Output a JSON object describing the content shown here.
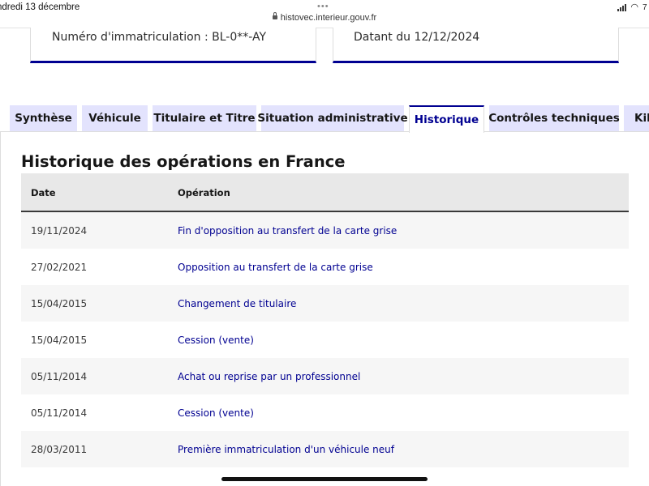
{
  "status_bar": {
    "date": "ndredi 13 décembre",
    "url": "histovec.interieur.gouv.fr",
    "battery_partial": "7"
  },
  "cards": {
    "left": "Numéro d'immatriculation : BL-0**-AY",
    "right": "Datant du 12/12/2024"
  },
  "tabs": [
    {
      "label": "Synthèse",
      "active": false
    },
    {
      "label": "Véhicule",
      "active": false
    },
    {
      "label": "Titulaire et Titre",
      "active": false
    },
    {
      "label": "Situation administrative",
      "active": false
    },
    {
      "label": "Historique",
      "active": true
    },
    {
      "label": "Contrôles techniques",
      "active": false
    },
    {
      "label": "Kilo",
      "active": false
    }
  ],
  "section": {
    "title": "Historique des opérations en France"
  },
  "table": {
    "headers": {
      "date": "Date",
      "operation": "Opération"
    },
    "rows": [
      {
        "date": "19/11/2024",
        "operation": "Fin d'opposition au transfert de la carte grise"
      },
      {
        "date": "27/02/2021",
        "operation": "Opposition au transfert de la carte grise"
      },
      {
        "date": "15/04/2015",
        "operation": "Changement de titulaire"
      },
      {
        "date": "15/04/2015",
        "operation": "Cession (vente)"
      },
      {
        "date": "05/11/2014",
        "operation": "Achat ou reprise par un professionnel"
      },
      {
        "date": "05/11/2014",
        "operation": "Cession (vente)"
      },
      {
        "date": "28/03/2011",
        "operation": "Première immatriculation d'un véhicule neuf"
      }
    ]
  },
  "colors": {
    "accent": "#000091",
    "tab_inactive_bg": "#e3e3fd",
    "header_bg": "#e8e8e8",
    "row_alt_bg": "#f6f6f6"
  }
}
